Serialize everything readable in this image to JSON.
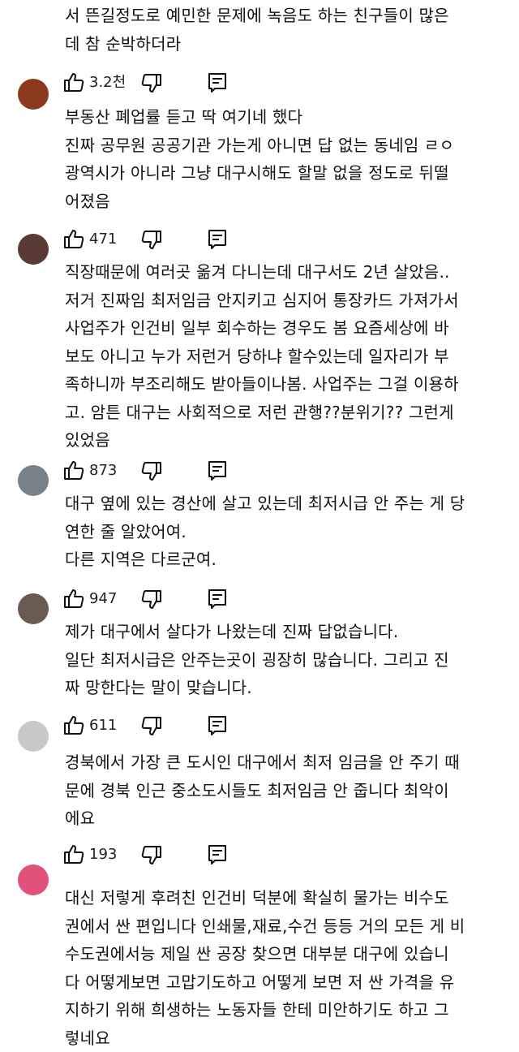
{
  "comments": [
    {
      "lines": [
        "서 뜬길정도로 예민한 문제에 녹음도 하는 친구들이 많은",
        "데 참 순박하더라"
      ],
      "likes": "3.2천",
      "avatar_color": "#ffffff"
    },
    {
      "lines": [
        "부동산 폐업률 듣고 딱 여기네 했다",
        "진짜 공무원 공공기관 가는게 아니면 답 없는 동네임 ㄹㅇ",
        "광역시가 아니라 그냥 대구시해도 할말 없을 정도로 뒤떨",
        "어졌음"
      ],
      "likes": "471",
      "avatar_color": "#8b3a1e"
    },
    {
      "lines": [
        "직장때문에 여러곳 옮겨 다니는데 대구서도 2년 살았음..",
        "저거 진짜임 최저임금 안지키고 심지어 통장카드 가져가서",
        "사업주가 인건비 일부 회수하는 경우도 봄 요즘세상에 바",
        "보도 아니고 누가 저런거 당하냐 할수있는데 일자리가 부",
        "족하니까 부조리해도 받아들이나봄. 사업주는 그걸 이용하",
        "고. 암튼 대구는 사회적으로 저런 관행??분위기?? 그런게",
        "있었음"
      ],
      "likes": "873",
      "avatar_color": "#5a3a32"
    },
    {
      "lines": [
        "대구 옆에 있는 경산에 살고 있는데 최저시급 안 주는 게 당",
        "연한 줄 알았어여.",
        "다른 지역은 다르군여."
      ],
      "likes": "947",
      "avatar_color": "#7a8088"
    },
    {
      "lines": [
        "제가 대구에서 살다가 나왔는데 진짜 답없습니다.",
        "일단 최저시급은 안주는곳이 굉장히 많습니다. 그리고 진",
        "짜 망한다는 말이 맞습니다."
      ],
      "likes": "611",
      "avatar_color": "#6b5a52"
    },
    {
      "lines": [
        "경북에서 가장 큰 도시인 대구에서 최저 임금을 안 주기 때",
        "문에 경북 인근 중소도시들도 최저임금 안 줍니다 최악이",
        "에요"
      ],
      "likes": "193",
      "avatar_color": "#c8c8c8"
    },
    {
      "lines": [
        "대신 저렇게 후려친 인건비 덕분에 확실히 물가는 비수도",
        "권에서 싼 편입니다 인쇄물,재료,수건 등등 거의 모든 게 비",
        "수도권에서능 제일 싼 공장 찾으면 대부분 대구에 있습니",
        "다 어떻게보면 고맙기도하고 어떻게 보면 저 싼 가격을 유",
        "지하기 위해 희생하는 노동자들 한테 미안하기도 하고 그",
        "렇네요"
      ],
      "likes": "",
      "avatar_color": "#e0527a"
    }
  ],
  "icons": {
    "like": "thumbs-up-icon",
    "dislike": "thumbs-down-icon",
    "reply": "reply-comment-icon"
  }
}
